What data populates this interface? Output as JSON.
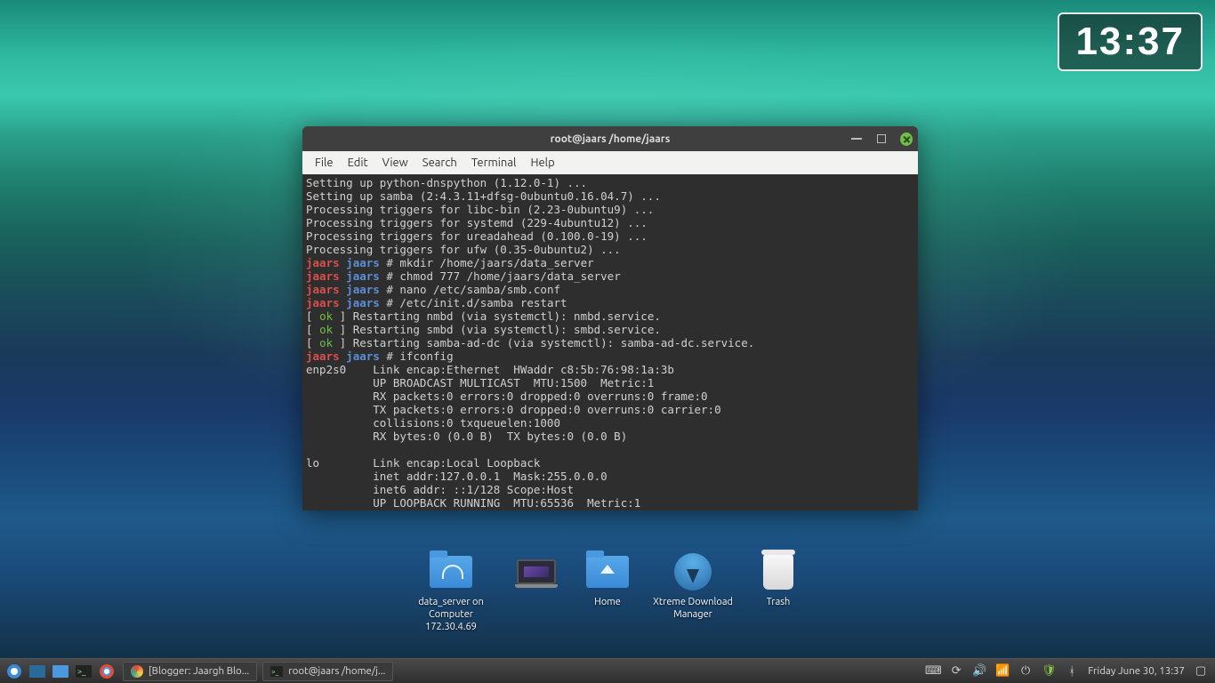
{
  "clock_widget": {
    "time": "13:37"
  },
  "terminal": {
    "title": "root@jaars /home/jaars",
    "menu": {
      "file": "File",
      "edit": "Edit",
      "view": "View",
      "search": "Search",
      "terminal": "Terminal",
      "help": "Help"
    },
    "lines": {
      "l0": "Setting up python-dnspython (1.12.0-1) ...",
      "l1": "Setting up samba (2:4.3.11+dfsg-0ubuntu0.16.04.7) ...",
      "l2": "Processing triggers for libc-bin (2.23-0ubuntu9) ...",
      "l3": "Processing triggers for systemd (229-4ubuntu12) ...",
      "l4": "Processing triggers for ureadahead (0.100.0-19) ...",
      "l5": "Processing triggers for ufw (0.35-0ubuntu2) ...",
      "p0_user": "jaars",
      "p0_host": "jaars",
      "p0_sep": " # ",
      "p0_cmd": "mkdir /home/jaars/data_server",
      "p1_cmd": "chmod 777 /home/jaars/data_server",
      "p2_cmd": "nano /etc/samba/smb.conf",
      "p3_cmd": "/etc/init.d/samba restart",
      "ok_lb": "[ ",
      "ok_txt": "ok",
      "ok_rb": " ] ",
      "r0": "Restarting nmbd (via systemctl): nmbd.service.",
      "r1": "Restarting smbd (via systemctl): smbd.service.",
      "r2": "Restarting samba-ad-dc (via systemctl): samba-ad-dc.service.",
      "p4_cmd": "ifconfig",
      "if0": "enp2s0    Link encap:Ethernet  HWaddr c8:5b:76:98:1a:3b",
      "if1": "          UP BROADCAST MULTICAST  MTU:1500  Metric:1",
      "if2": "          RX packets:0 errors:0 dropped:0 overruns:0 frame:0",
      "if3": "          TX packets:0 errors:0 dropped:0 overruns:0 carrier:0",
      "if4": "          collisions:0 txqueuelen:1000",
      "if5": "          RX bytes:0 (0.0 B)  TX bytes:0 (0.0 B)",
      "blank": "",
      "lo0": "lo        Link encap:Local Loopback",
      "lo1": "          inet addr:127.0.0.1  Mask:255.0.0.0",
      "lo2": "          inet6 addr: ::1/128 Scope:Host",
      "lo3": "          UP LOOPBACK RUNNING  MTU:65536  Metric:1"
    }
  },
  "desktop": {
    "icons": {
      "data_server": "data_server on Computer 172.30.4.69",
      "home": "Home",
      "xdm": "Xtreme Download Manager",
      "trash": "Trash"
    }
  },
  "taskbar": {
    "task1": "[Blogger: Jaargh Blo...",
    "task2": "root@jaars /home/j...",
    "datetime": "Friday June 30, 13:37"
  }
}
